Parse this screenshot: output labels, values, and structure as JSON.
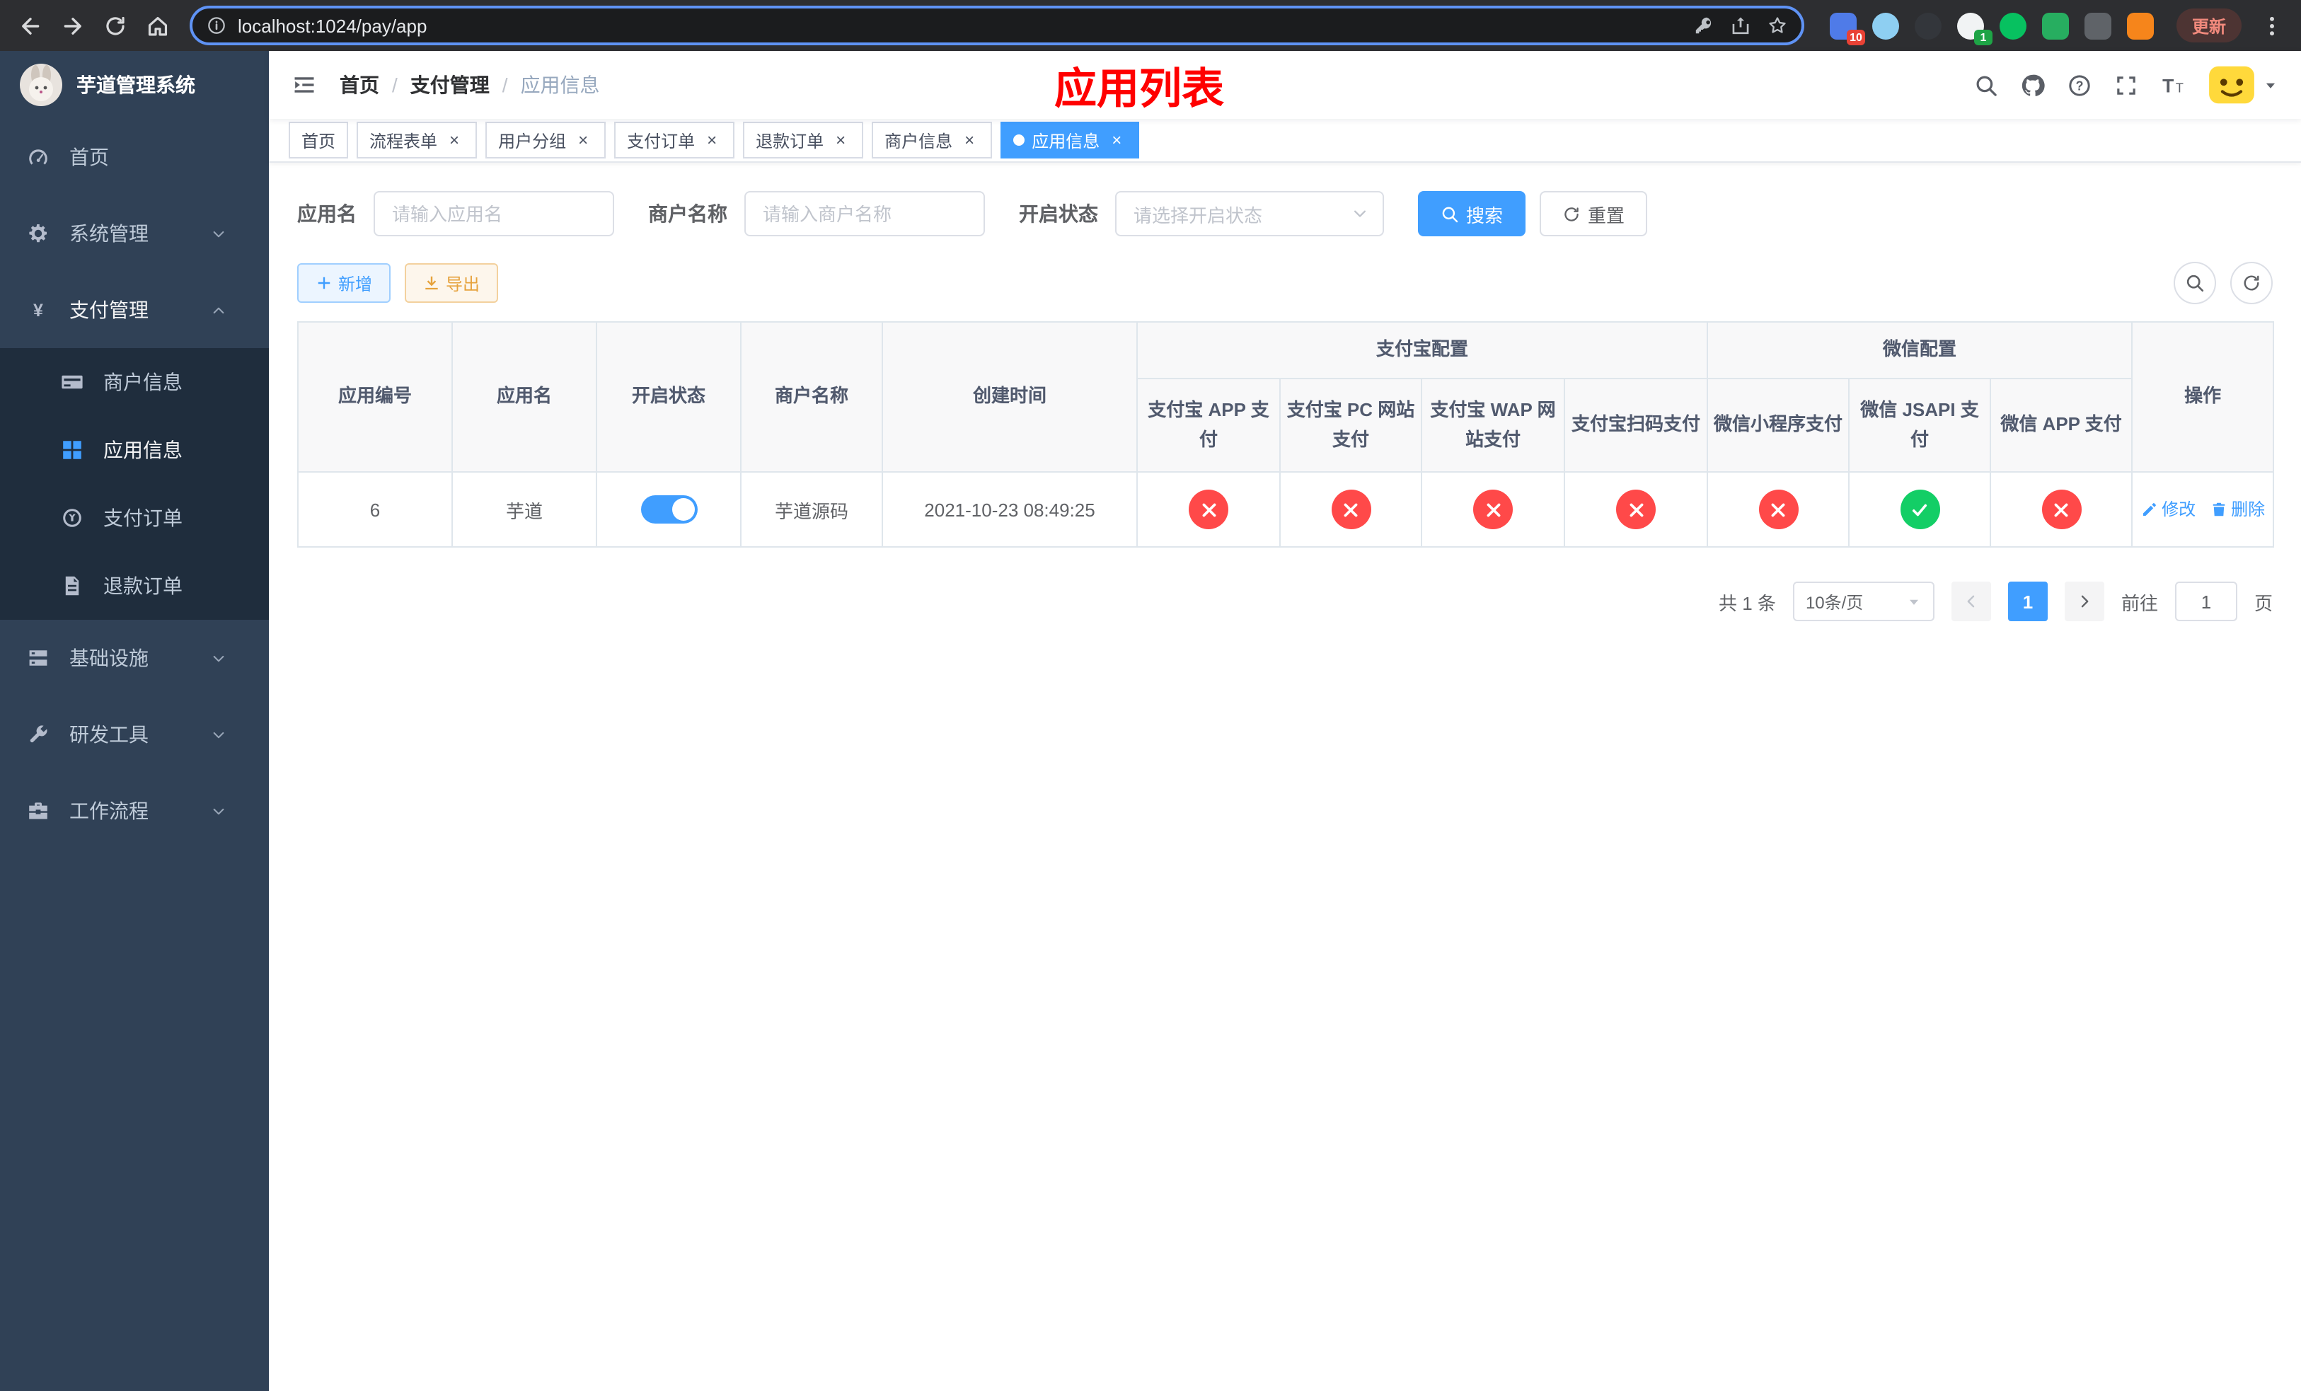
{
  "colors": {
    "accent": "#409eff",
    "danger": "#ff4949",
    "success": "#13ce66",
    "page_title_red": "#ff0000",
    "sidebar_bg": "#304156",
    "submenu_bg": "#1f2d3d"
  },
  "browser": {
    "url": "localhost:1024/pay/app",
    "update_label": "更新",
    "extensions": [
      {
        "color": "#4f7be8",
        "shape": "square",
        "badge": "10",
        "badge_color": "#e94235"
      },
      {
        "color": "#8ecff2",
        "shape": "circle"
      },
      {
        "color": "#33363b",
        "shape": "circle"
      },
      {
        "color": "#f1f3f4",
        "shape": "circle",
        "badge": "1",
        "badge_color": "#1ea446"
      },
      {
        "color": "#07c160",
        "shape": "circle"
      },
      {
        "color": "#27ae60",
        "shape": "square"
      },
      {
        "color": "#5f6368",
        "shape": "square"
      },
      {
        "color": "#f6851b",
        "shape": "square"
      }
    ]
  },
  "sidebar": {
    "app_title": "芋道管理系统",
    "items": [
      {
        "label": "首页",
        "icon": "dashboard"
      },
      {
        "label": "系统管理",
        "icon": "gear",
        "group": true
      },
      {
        "label": "支付管理",
        "icon": "yen",
        "group": true,
        "expanded": true,
        "children": [
          {
            "label": "商户信息",
            "icon": "card"
          },
          {
            "label": "应用信息",
            "icon": "grid",
            "active": true
          },
          {
            "label": "支付订单",
            "icon": "coin"
          },
          {
            "label": "退款订单",
            "icon": "doc"
          }
        ]
      },
      {
        "label": "基础设施",
        "icon": "infra",
        "group": true
      },
      {
        "label": "研发工具",
        "icon": "tool",
        "group": true
      },
      {
        "label": "工作流程",
        "icon": "flow",
        "group": true
      }
    ]
  },
  "navbar": {
    "breadcrumb": [
      "首页",
      "支付管理",
      "应用信息"
    ],
    "page_title": "应用列表"
  },
  "tabs": [
    {
      "label": "首页",
      "closable": false
    },
    {
      "label": "流程表单",
      "closable": true
    },
    {
      "label": "用户分组",
      "closable": true
    },
    {
      "label": "支付订单",
      "closable": true
    },
    {
      "label": "退款订单",
      "closable": true
    },
    {
      "label": "商户信息",
      "closable": true
    },
    {
      "label": "应用信息",
      "closable": true,
      "active": true
    }
  ],
  "filters": {
    "app_name_label": "应用名",
    "app_name_placeholder": "请输入应用名",
    "merchant_label": "商户名称",
    "merchant_placeholder": "请输入商户名称",
    "status_label": "开启状态",
    "status_placeholder": "请选择开启状态",
    "search_label": "搜索",
    "reset_label": "重置"
  },
  "toolbar": {
    "add_label": "新增",
    "export_label": "导出"
  },
  "table": {
    "plain_columns": [
      "应用编号",
      "应用名",
      "开启状态",
      "商户名称",
      "创建时间"
    ],
    "groups": [
      {
        "label": "支付宝配置",
        "columns": [
          "支付宝 APP 支付",
          "支付宝 PC 网站支付",
          "支付宝 WAP 网站支付",
          "支付宝扫码支付"
        ]
      },
      {
        "label": "微信配置",
        "columns": [
          "微信小程序支付",
          "微信 JSAPI 支付",
          "微信 APP 支付"
        ]
      }
    ],
    "action_column": "操作",
    "rows": [
      {
        "id": "6",
        "name": "芋道",
        "enabled": true,
        "merchant": "芋道源码",
        "created": "2021-10-23 08:49:25",
        "channels": [
          false,
          false,
          false,
          false,
          false,
          true,
          false
        ],
        "edit_label": "修改",
        "delete_label": "删除"
      }
    ]
  },
  "pagination": {
    "total_label": "共 1 条",
    "page_size_label": "10条/页",
    "current_page": "1",
    "goto_label": "前往",
    "goto_value": "1",
    "goto_unit": "页"
  }
}
